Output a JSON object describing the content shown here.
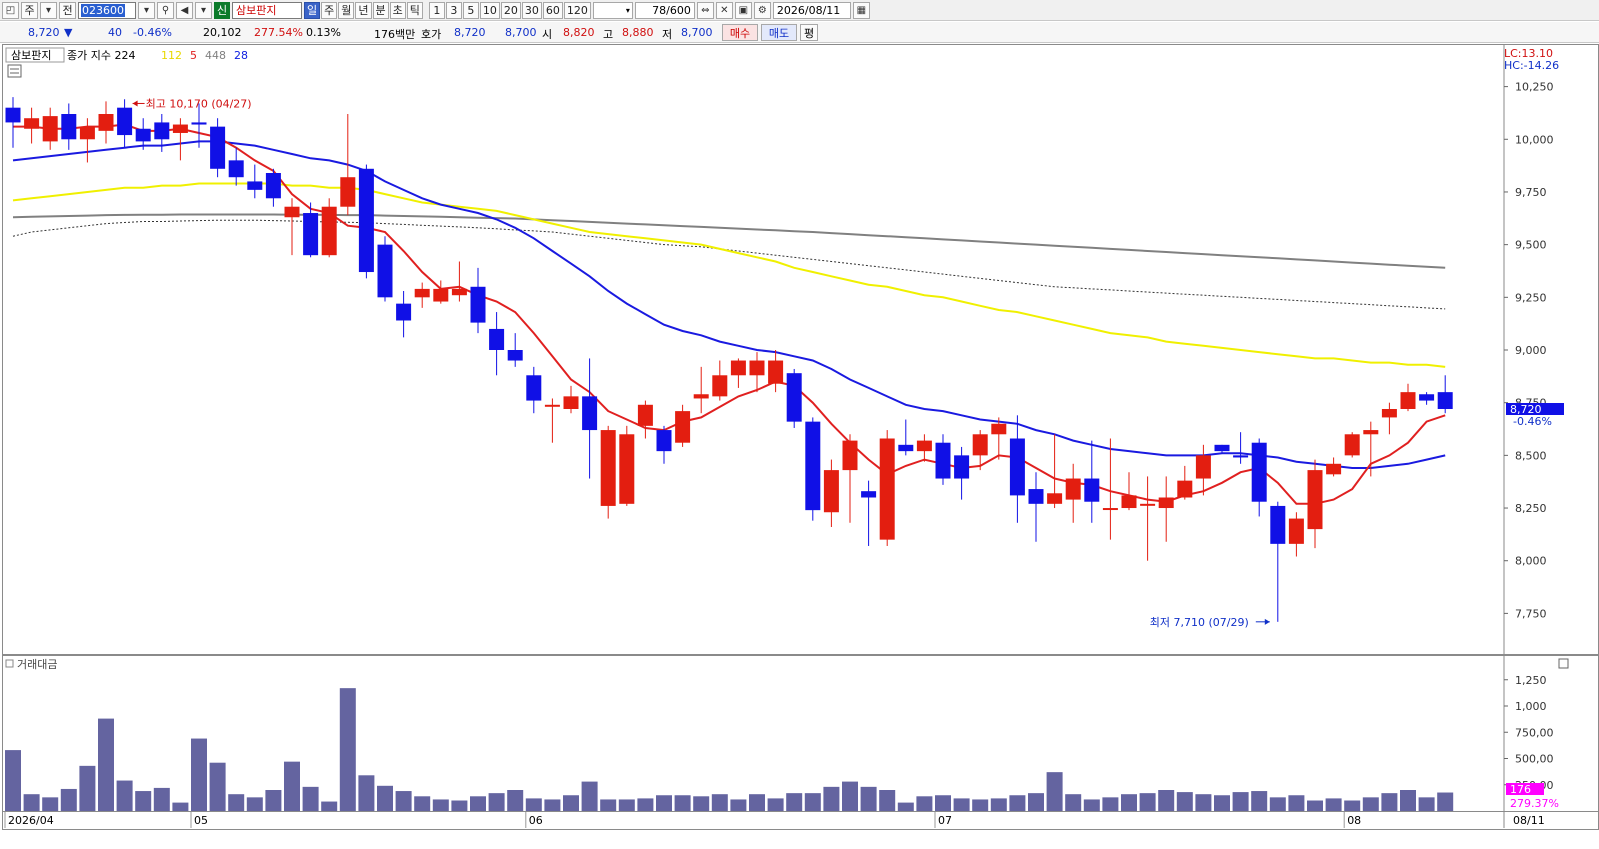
{
  "toolbar": {
    "btn_stock": "주",
    "btn_prev": "전",
    "code": "023600",
    "new_badge": "신",
    "stock_name": "삼보판지",
    "periods": [
      "일",
      "주",
      "월",
      "년",
      "분",
      "초",
      "틱"
    ],
    "active_period": "일",
    "intervals": [
      "1",
      "3",
      "5",
      "10",
      "20",
      "30",
      "60",
      "120"
    ],
    "count": "78/600",
    "date": "2026/08/11"
  },
  "quote": {
    "price": "8,720",
    "change_arrow": "▼",
    "change": "40",
    "change_pct": "-0.46%",
    "volume": "20,102",
    "volume_ratio": "277.54%",
    "turnover": "0.13%",
    "amount": "176백만",
    "hoga_label": "호가",
    "ask": "8,720",
    "bid": "8,700",
    "open_label": "시",
    "open": "8,820",
    "high_label": "고",
    "high": "8,880",
    "low_label": "저",
    "low": "8,700",
    "buy_btn": "매수",
    "sell_btn": "매도",
    "avg_btn": "평"
  },
  "price_panel": {
    "legend_name": "삼보판지",
    "legend_text": "종가 지수 224",
    "ma_labels": [
      {
        "text": "112",
        "color": "#e8d800"
      },
      {
        "text": "5",
        "color": "#e02020"
      },
      {
        "text": "448",
        "color": "#808080"
      },
      {
        "text": "28",
        "color": "#1020e0"
      }
    ],
    "lc": "LC:13.10",
    "hc": "HC:-14.26",
    "last_price_tag": "8,720",
    "last_pct_tag": "-0.46%",
    "high_annotation": "최고 10,170 (04/27)",
    "low_annotation": "최저 7,710 (07/29)",
    "y_ticks": [
      "10,250",
      "10,000",
      "9,750",
      "9,500",
      "9,250",
      "9,000",
      "8,750",
      "8,500",
      "8,250",
      "8,000",
      "7,750"
    ]
  },
  "volume_panel": {
    "legend": "거래대금",
    "y_ticks": [
      "1,250",
      "1,000",
      "750,00",
      "500,00",
      "250,00"
    ],
    "last_value_tag": "176",
    "last_pct_tag": "279.37%"
  },
  "x_axis": {
    "labels": [
      {
        "text": "2026/04",
        "idx": 0
      },
      {
        "text": "05",
        "idx": 10
      },
      {
        "text": "06",
        "idx": 28
      },
      {
        "text": "07",
        "idx": 50
      },
      {
        "text": "08",
        "idx": 72
      }
    ],
    "right_label": "08/11"
  },
  "colors": {
    "up": "#e31e10",
    "down": "#1010e6",
    "ma5": "#e02020",
    "ma28": "#1a1ae0",
    "ma112": "#f0f000",
    "ma448": "#808080",
    "volume": "#6464a0"
  },
  "chart_data": {
    "type": "candlestick",
    "y_range": [
      7600,
      10400
    ],
    "candles": [
      [
        10150,
        10080,
        10200,
        9960
      ],
      [
        10050,
        10100,
        10150,
        9980
      ],
      [
        9990,
        10110,
        10150,
        9950
      ],
      [
        10120,
        10000,
        10170,
        9950
      ],
      [
        10000,
        10060,
        10100,
        9890
      ],
      [
        10040,
        10120,
        10180,
        9980
      ],
      [
        10150,
        10020,
        10190,
        9960
      ],
      [
        10050,
        9990,
        10100,
        9950
      ],
      [
        10080,
        10000,
        10120,
        9940
      ],
      [
        10030,
        10070,
        10100,
        9900
      ],
      [
        10080,
        10070,
        10170,
        9960
      ],
      [
        10060,
        9860,
        10100,
        9820
      ],
      [
        9900,
        9820,
        9960,
        9780
      ],
      [
        9800,
        9760,
        9880,
        9720
      ],
      [
        9840,
        9720,
        9860,
        9680
      ],
      [
        9630,
        9680,
        9720,
        9450
      ],
      [
        9650,
        9450,
        9700,
        9440
      ],
      [
        9450,
        9680,
        9720,
        9440
      ],
      [
        9680,
        9820,
        10120,
        9640
      ],
      [
        9860,
        9370,
        9880,
        9340
      ],
      [
        9500,
        9250,
        9540,
        9230
      ],
      [
        9220,
        9140,
        9280,
        9060
      ],
      [
        9250,
        9290,
        9320,
        9200
      ],
      [
        9230,
        9290,
        9330,
        9220
      ],
      [
        9260,
        9290,
        9420,
        9230
      ],
      [
        9300,
        9130,
        9390,
        9080
      ],
      [
        9100,
        9000,
        9180,
        8880
      ],
      [
        9000,
        8950,
        9080,
        8920
      ],
      [
        8880,
        8760,
        8920,
        8700
      ],
      [
        8740,
        8740,
        8770,
        8560
      ],
      [
        8720,
        8780,
        8830,
        8700
      ],
      [
        8780,
        8620,
        8960,
        8390
      ],
      [
        8260,
        8620,
        8640,
        8200
      ],
      [
        8270,
        8600,
        8640,
        8260
      ],
      [
        8640,
        8740,
        8760,
        8580
      ],
      [
        8620,
        8520,
        8640,
        8460
      ],
      [
        8560,
        8710,
        8740,
        8540
      ],
      [
        8770,
        8790,
        8920,
        8700
      ],
      [
        8780,
        8880,
        8950,
        8760
      ],
      [
        8880,
        8950,
        8960,
        8820
      ],
      [
        8880,
        8950,
        8990,
        8800
      ],
      [
        8840,
        8950,
        9000,
        8800
      ],
      [
        8890,
        8660,
        8910,
        8630
      ],
      [
        8660,
        8240,
        8680,
        8190
      ],
      [
        8230,
        8430,
        8480,
        8160
      ],
      [
        8430,
        8570,
        8600,
        8180
      ],
      [
        8330,
        8300,
        8380,
        8070
      ],
      [
        8100,
        8580,
        8620,
        8070
      ],
      [
        8550,
        8520,
        8670,
        8500
      ],
      [
        8520,
        8570,
        8600,
        8470
      ],
      [
        8560,
        8390,
        8600,
        8360
      ],
      [
        8500,
        8390,
        8540,
        8290
      ],
      [
        8500,
        8600,
        8620,
        8430
      ],
      [
        8600,
        8650,
        8680,
        8480
      ],
      [
        8580,
        8310,
        8690,
        8180
      ],
      [
        8340,
        8270,
        8420,
        8090
      ],
      [
        8270,
        8320,
        8600,
        8250
      ],
      [
        8290,
        8390,
        8460,
        8180
      ],
      [
        8390,
        8280,
        8570,
        8180
      ],
      [
        8250,
        8250,
        8580,
        8100
      ],
      [
        8250,
        8310,
        8420,
        8240
      ],
      [
        8270,
        8270,
        8400,
        8000
      ],
      [
        8250,
        8300,
        8400,
        8090
      ],
      [
        8300,
        8380,
        8450,
        8290
      ],
      [
        8390,
        8500,
        8550,
        8310
      ],
      [
        8550,
        8520,
        8550,
        8510
      ],
      [
        8500,
        8490,
        8610,
        8460
      ],
      [
        8560,
        8280,
        8580,
        8210
      ],
      [
        8260,
        8080,
        8280,
        7710
      ],
      [
        8080,
        8200,
        8230,
        8020
      ],
      [
        8150,
        8430,
        8480,
        8060
      ],
      [
        8410,
        8460,
        8490,
        8400
      ],
      [
        8500,
        8600,
        8610,
        8490
      ],
      [
        8600,
        8620,
        8660,
        8400
      ],
      [
        8680,
        8720,
        8750,
        8600
      ],
      [
        8720,
        8800,
        8840,
        8710
      ],
      [
        8790,
        8760,
        8800,
        8740
      ],
      [
        8800,
        8720,
        8880,
        8700
      ]
    ],
    "ma5": [
      10060,
      10060,
      10050,
      10050,
      10060,
      10060,
      10070,
      10040,
      10040,
      10050,
      10030,
      10010,
      9960,
      9900,
      9850,
      9740,
      9670,
      9650,
      9590,
      9580,
      9560,
      9470,
      9370,
      9290,
      9300,
      9260,
      9230,
      9180,
      9080,
      8970,
      8860,
      8800,
      8710,
      8670,
      8630,
      8620,
      8660,
      8680,
      8730,
      8780,
      8810,
      8850,
      8830,
      8750,
      8650,
      8560,
      8480,
      8410,
      8450,
      8480,
      8460,
      8440,
      8450,
      8500,
      8490,
      8440,
      8390,
      8370,
      8360,
      8330,
      8310,
      8290,
      8280,
      8310,
      8330,
      8370,
      8420,
      8440,
      8370,
      8270,
      8270,
      8290,
      8340,
      8460,
      8500,
      8560,
      8660,
      8690
    ],
    "ma28": [
      9900,
      9910,
      9920,
      9930,
      9940,
      9950,
      9960,
      9970,
      9970,
      9980,
      9990,
      9990,
      9980,
      9970,
      9950,
      9930,
      9910,
      9900,
      9880,
      9850,
      9800,
      9760,
      9720,
      9690,
      9670,
      9650,
      9620,
      9580,
      9530,
      9470,
      9410,
      9350,
      9280,
      9220,
      9170,
      9120,
      9090,
      9070,
      9040,
      9020,
      9000,
      8990,
      8970,
      8950,
      8910,
      8860,
      8820,
      8780,
      8740,
      8720,
      8710,
      8690,
      8670,
      8660,
      8650,
      8620,
      8600,
      8570,
      8550,
      8530,
      8520,
      8510,
      8500,
      8500,
      8500,
      8510,
      8510,
      8500,
      8490,
      8470,
      8460,
      8450,
      8440,
      8440,
      8450,
      8460,
      8480,
      8500
    ],
    "ma112": [
      9710,
      9720,
      9730,
      9740,
      9750,
      9760,
      9770,
      9770,
      9780,
      9780,
      9790,
      9790,
      9790,
      9790,
      9790,
      9780,
      9780,
      9770,
      9770,
      9760,
      9740,
      9720,
      9700,
      9690,
      9680,
      9670,
      9660,
      9640,
      9620,
      9600,
      9580,
      9560,
      9550,
      9540,
      9530,
      9520,
      9510,
      9500,
      9480,
      9460,
      9440,
      9420,
      9390,
      9370,
      9350,
      9330,
      9310,
      9300,
      9280,
      9260,
      9250,
      9230,
      9210,
      9190,
      9180,
      9160,
      9140,
      9120,
      9100,
      9080,
      9070,
      9060,
      9040,
      9030,
      9020,
      9010,
      9000,
      8990,
      8980,
      8970,
      8960,
      8960,
      8950,
      8940,
      8940,
      8930,
      8930,
      8920
    ],
    "ma448": [
      9630,
      9632,
      9634,
      9636,
      9638,
      9640,
      9641,
      9642,
      9642,
      9643,
      9643,
      9643,
      9643,
      9643,
      9643,
      9642,
      9642,
      9641,
      9640,
      9640,
      9638,
      9636,
      9634,
      9632,
      9630,
      9628,
      9626,
      9624,
      9620,
      9616,
      9612,
      9608,
      9604,
      9600,
      9596,
      9592,
      9588,
      9584,
      9580,
      9576,
      9572,
      9568,
      9564,
      9560,
      9555,
      9550,
      9545,
      9540,
      9535,
      9530,
      9525,
      9520,
      9515,
      9510,
      9505,
      9500,
      9495,
      9490,
      9485,
      9480,
      9475,
      9470,
      9465,
      9460,
      9455,
      9450,
      9445,
      9440,
      9435,
      9430,
      9425,
      9420,
      9415,
      9410,
      9405,
      9400,
      9395,
      9390
    ],
    "ma_dotted": [
      9540,
      9560,
      9570,
      9580,
      9590,
      9600,
      9605,
      9610,
      9610,
      9612,
      9614,
      9616,
      9616,
      9616,
      9614,
      9612,
      9610,
      9608,
      9606,
      9604,
      9600,
      9596,
      9592,
      9588,
      9584,
      9580,
      9575,
      9570,
      9565,
      9560,
      9550,
      9540,
      9530,
      9520,
      9510,
      9500,
      9495,
      9490,
      9480,
      9470,
      9460,
      9450,
      9440,
      9430,
      9420,
      9410,
      9400,
      9390,
      9380,
      9370,
      9360,
      9350,
      9340,
      9330,
      9320,
      9310,
      9300,
      9295,
      9290,
      9285,
      9280,
      9275,
      9270,
      9265,
      9260,
      9255,
      9250,
      9245,
      9240,
      9235,
      9230,
      9225,
      9220,
      9215,
      9210,
      9205,
      9200,
      9195
    ],
    "volume": [
      580,
      160,
      130,
      210,
      430,
      880,
      290,
      190,
      220,
      80,
      690,
      460,
      160,
      130,
      200,
      470,
      230,
      90,
      1170,
      340,
      240,
      190,
      140,
      110,
      100,
      140,
      170,
      200,
      120,
      110,
      150,
      280,
      110,
      110,
      120,
      150,
      150,
      140,
      160,
      110,
      160,
      120,
      170,
      170,
      230,
      280,
      230,
      200,
      80,
      140,
      150,
      120,
      110,
      120,
      150,
      170,
      370,
      160,
      110,
      130,
      160,
      170,
      200,
      180,
      160,
      150,
      180,
      190,
      130,
      150,
      100,
      120,
      100,
      130,
      170,
      200,
      130,
      176
    ],
    "volume_range": [
      0,
      1400
    ]
  }
}
